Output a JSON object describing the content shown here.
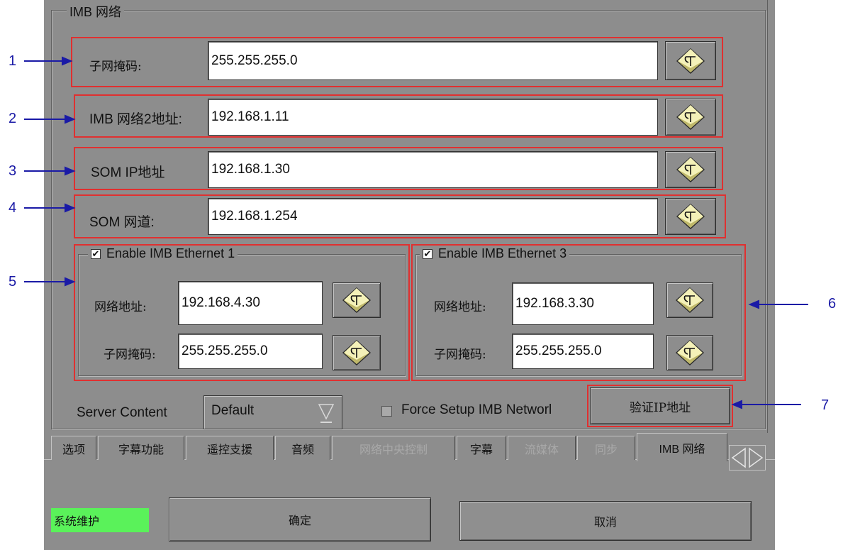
{
  "group_title": "IMB 网络",
  "rows": [
    {
      "number": "1",
      "label": "子网掩码:",
      "value": "255.255.255.0"
    },
    {
      "number": "2",
      "label": "IMB 网络2地址:",
      "value": "192.168.1.11"
    },
    {
      "number": "3",
      "label": "SOM IP地址",
      "value": "192.168.1.30"
    },
    {
      "number": "4",
      "label": "SOM 网道:",
      "value": "192.168.1.254"
    }
  ],
  "eth1": {
    "number": "5",
    "title": "Enable IMB Ethernet 1",
    "checked_glyph": "✔",
    "addr_label": "网络地址:",
    "addr_value": "192.168.4.30",
    "mask_label": "子网掩码:",
    "mask_value": "255.255.255.0"
  },
  "eth3": {
    "number": "6",
    "title": "Enable IMB Ethernet 3",
    "checked_glyph": "✔",
    "addr_label": "网络地址:",
    "addr_value": "192.168.3.30",
    "mask_label": "子网掩码:",
    "mask_value": "255.255.255.0"
  },
  "server_content": {
    "label": "Server Content",
    "value": "Default"
  },
  "force_setup": {
    "label": "Force Setup IMB Networl"
  },
  "verify": {
    "number": "7",
    "label": "验证IP地址"
  },
  "tabs": [
    {
      "label": "选项",
      "state": "normal"
    },
    {
      "label": "字幕功能",
      "state": "normal"
    },
    {
      "label": "遥控支援",
      "state": "normal"
    },
    {
      "label": "音频",
      "state": "normal"
    },
    {
      "label": "网络中央控制",
      "state": "disabled"
    },
    {
      "label": "字幕",
      "state": "normal"
    },
    {
      "label": "流媒体",
      "state": "disabled"
    },
    {
      "label": "同步",
      "state": "disabled"
    },
    {
      "label": "IMB 网络",
      "state": "active"
    }
  ],
  "status": {
    "label": "系统维护",
    "color": "#5af25a"
  },
  "ok_label": "确定",
  "cancel_label": "取消",
  "colors": {
    "panel": "#8d8d8d",
    "annotation_red": "#e03030",
    "annotation_blue": "#1a1aa6"
  },
  "icons": {
    "keyboard_button": "keyboard-icon"
  }
}
